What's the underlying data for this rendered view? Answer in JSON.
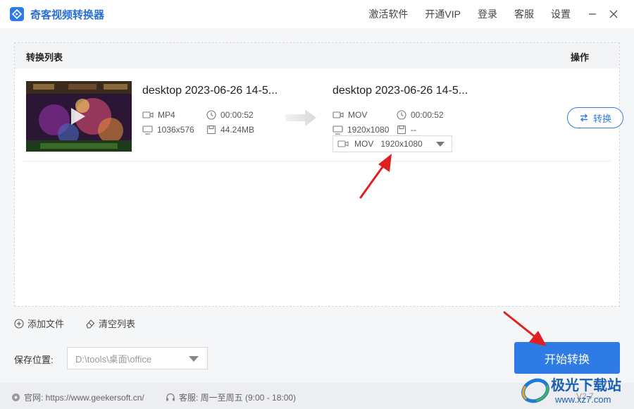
{
  "app": {
    "title": "奇客视频转换器",
    "menu": [
      "激活软件",
      "开通VIP",
      "登录",
      "客服",
      "设置"
    ]
  },
  "list": {
    "header_title": "转换列表",
    "header_ops": "操作",
    "items": [
      {
        "source": {
          "name": "desktop 2023-06-26 14-5...",
          "format": "MP4",
          "duration": "00:00:52",
          "resolution": "1036x576",
          "size": "44.24MB"
        },
        "target": {
          "name": "desktop 2023-06-26 14-5...",
          "format": "MOV",
          "duration": "00:00:52",
          "resolution": "1920x1080",
          "size": "--"
        },
        "output_select": {
          "format": "MOV",
          "resolution": "1920x1080"
        },
        "convert_label": "转换"
      }
    ]
  },
  "tools": {
    "add_file": "添加文件",
    "clear_list": "清空列表"
  },
  "save": {
    "label": "保存位置:",
    "path": "D:\\tools\\桌面\\office"
  },
  "start_button": "开始转换",
  "status": {
    "site": "官网: https://www.geekersoft.cn/",
    "service": "客服: 周一至周五 (9:00 - 18:00)",
    "version": "V2.7"
  },
  "watermark": {
    "text": "极光下载站",
    "url": "www.xz7.com"
  },
  "colors": {
    "accent": "#2f7be5",
    "annotation": "#e02020"
  }
}
